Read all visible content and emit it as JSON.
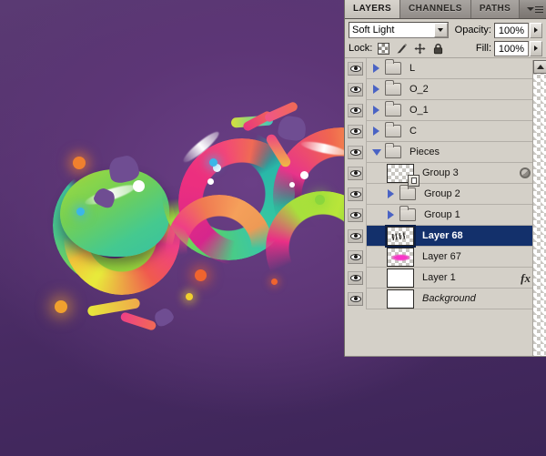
{
  "app": {
    "panel_tabs": [
      {
        "label": "LAYERS",
        "active": true
      },
      {
        "label": "CHANNELS",
        "active": false
      },
      {
        "label": "PATHS",
        "active": false
      }
    ],
    "panel_menu_icon": "panel-menu-icon"
  },
  "options": {
    "blend_mode": "Soft Light",
    "opacity_label": "Opacity:",
    "opacity_value": "100%",
    "fill_label": "Fill:",
    "fill_value": "100%",
    "lock_label": "Lock:",
    "lock_icons": [
      "lock-transparent-pixels-icon",
      "lock-image-pixels-icon",
      "lock-position-icon",
      "lock-all-icon"
    ]
  },
  "layers": [
    {
      "name": "L",
      "type": "group",
      "indent": 0,
      "expanded": false,
      "visible": true,
      "selected": false,
      "thumb": "folder"
    },
    {
      "name": "O_2",
      "type": "group",
      "indent": 0,
      "expanded": false,
      "visible": true,
      "selected": false,
      "thumb": "folder"
    },
    {
      "name": "O_1",
      "type": "group",
      "indent": 0,
      "expanded": false,
      "visible": true,
      "selected": false,
      "thumb": "folder"
    },
    {
      "name": "C",
      "type": "group",
      "indent": 0,
      "expanded": false,
      "visible": true,
      "selected": false,
      "thumb": "folder"
    },
    {
      "name": "Pieces",
      "type": "group",
      "indent": 0,
      "expanded": true,
      "visible": true,
      "selected": false,
      "thumb": "folder"
    },
    {
      "name": "Group 3",
      "type": "layer",
      "indent": 1,
      "visible": true,
      "selected": false,
      "thumb": "checker-badge",
      "badges": [
        "adjustment-circle-icon",
        "expand-caret-icon"
      ]
    },
    {
      "name": "Group 2",
      "type": "group",
      "indent": 1,
      "expanded": false,
      "visible": true,
      "selected": false,
      "thumb": "folder"
    },
    {
      "name": "Group 1",
      "type": "group",
      "indent": 1,
      "expanded": false,
      "visible": true,
      "selected": false,
      "thumb": "folder"
    },
    {
      "name": "Layer 68",
      "type": "layer",
      "indent": 1,
      "visible": true,
      "selected": true,
      "thumb": "checker-scribble"
    },
    {
      "name": "Layer 67",
      "type": "layer",
      "indent": 1,
      "visible": true,
      "selected": false,
      "thumb": "checker-pink"
    },
    {
      "name": "Layer 1",
      "type": "layer",
      "indent": 1,
      "visible": true,
      "selected": false,
      "thumb": "white",
      "badges": [
        "fx-icon",
        "expand-caret-icon"
      ]
    },
    {
      "name": "Background",
      "type": "layer",
      "indent": 1,
      "visible": true,
      "selected": false,
      "thumb": "white",
      "italic": true,
      "badges": [
        "lock-icon"
      ]
    }
  ],
  "scrollbar": {
    "up_arrow_icon": "scroll-up-arrow-icon"
  },
  "colors": {
    "selection": "#13306b",
    "panel_bg": "#d4d0c8",
    "canvas_top": "#5a3a73",
    "canvas_bottom": "#3c2557",
    "disclosure_triangle": "#4a63c4"
  },
  "artwork": {
    "description": "Colorful glossy abstract rings artwork on purple gradient background"
  }
}
